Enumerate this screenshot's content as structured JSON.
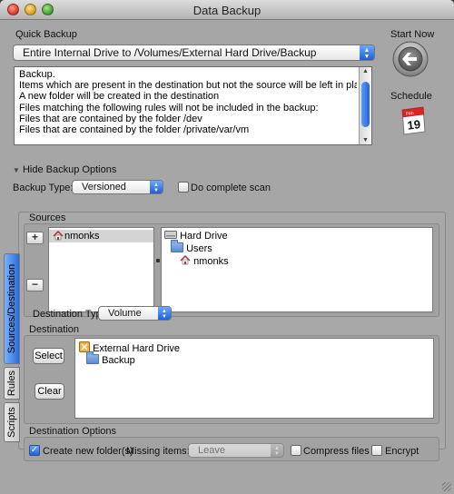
{
  "window": {
    "title": "Data Backup"
  },
  "quick_backup": {
    "label": "Quick Backup",
    "selected": "Entire Internal Drive to /Volumes/External Hard Drive/Backup"
  },
  "description_lines": [
    "Backup.",
    "Items which are present in the destination but not the source will be left in place",
    "A new folder will be created in the destination",
    "Files matching the following rules will not be included in the backup:",
    "Files that are contained by the folder /dev",
    "Files that are contained by the folder /private/var/vm"
  ],
  "start_now": {
    "label": "Start Now",
    "icon": "back-arrow-icon"
  },
  "schedule": {
    "label": "Schedule",
    "icon": "calendar-icon",
    "calendar_month": "Feb",
    "calendar_day": "19"
  },
  "options_toggle": {
    "label": "Hide Backup Options",
    "icon": "disclosure-triangle-icon"
  },
  "backup_type": {
    "label": "Backup Type:",
    "value": "Versioned"
  },
  "complete_scan": {
    "label": "Do complete scan",
    "checked": false
  },
  "tabs": [
    "Sources/Destination",
    "Rules",
    "Scripts"
  ],
  "sources": {
    "label": "Sources",
    "add_label": "+",
    "remove_label": "−",
    "list": [
      "nmonks"
    ],
    "tree": [
      {
        "label": "Hard Drive",
        "icon": "hard-drive-icon"
      },
      {
        "label": "Users",
        "icon": "folder-icon"
      },
      {
        "label": "nmonks",
        "icon": "home-icon"
      }
    ]
  },
  "destination_type": {
    "label": "Destination Type:",
    "value": "Volume"
  },
  "destination": {
    "label": "Destination",
    "select_label": "Select",
    "clear_label": "Clear",
    "tree": [
      {
        "label": "External Hard Drive",
        "icon": "external-drive-icon"
      },
      {
        "label": "Backup",
        "icon": "folder-icon"
      }
    ]
  },
  "destination_options": {
    "label": "Destination Options",
    "create_folders": {
      "label": "Create new folder(s)",
      "checked": true
    },
    "missing_items": {
      "label": "Missing items:",
      "value": "Leave"
    },
    "compress": {
      "label": "Compress files",
      "checked": false
    },
    "encrypt": {
      "label": "Encrypt",
      "checked": false
    }
  },
  "colors": {
    "accent": "#2563d4",
    "window_bg": "#a6a6a6"
  }
}
